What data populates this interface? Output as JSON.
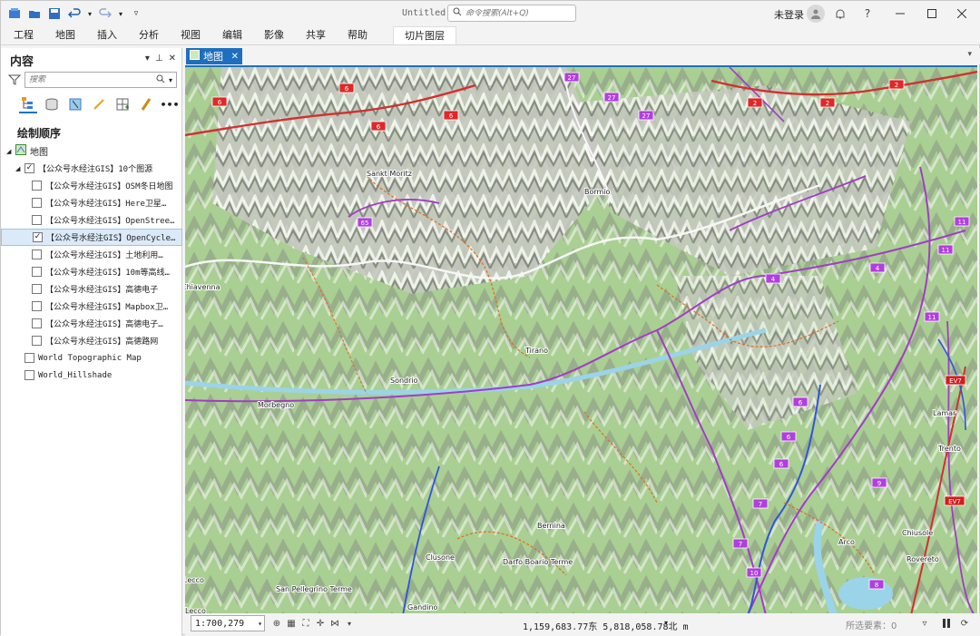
{
  "window": {
    "doc_title": "Untitled",
    "command_search_placeholder": "命令搜索(Alt+Q)",
    "account": "未登录"
  },
  "ribbon": {
    "tabs": [
      "工程",
      "地图",
      "插入",
      "分析",
      "视图",
      "编辑",
      "影像",
      "共享",
      "帮助"
    ],
    "context_tab": "切片图层"
  },
  "contents": {
    "title": "内容",
    "search_placeholder": "搜索",
    "drawing_order": "绘制顺序",
    "map_name": "地图",
    "group_name": "【公众号水经注GIS】10个图源",
    "layers": [
      {
        "name": "【公众号水经注GIS】OSM冬日地图",
        "checked": false,
        "selected": false
      },
      {
        "name": "【公众号水经注GIS】Here卫星…",
        "checked": false,
        "selected": false
      },
      {
        "name": "【公众号水经注GIS】OpenStree…",
        "checked": false,
        "selected": false
      },
      {
        "name": "【公众号水经注GIS】OpenCycle…",
        "checked": true,
        "selected": true
      },
      {
        "name": "【公众号水经注GIS】土地利用…",
        "checked": false,
        "selected": false
      },
      {
        "name": "【公众号水经注GIS】10m等高线…",
        "checked": false,
        "selected": false
      },
      {
        "name": "【公众号水经注GIS】高德电子",
        "checked": false,
        "selected": false
      },
      {
        "name": "【公众号水经注GIS】Mapbox卫…",
        "checked": false,
        "selected": false
      },
      {
        "name": "【公众号水经注GIS】高德电子…",
        "checked": false,
        "selected": false
      },
      {
        "name": "【公众号水经注GIS】高德路网",
        "checked": false,
        "selected": false
      }
    ],
    "basemaps": [
      "World Topographic Map",
      "World_Hillshade"
    ]
  },
  "map_tab": {
    "label": "地图"
  },
  "map": {
    "places": [
      "Sankt Moritz",
      "Bormio",
      "Chiavenna",
      "Tirano",
      "Sondrio",
      "Morbegno",
      "Bernina",
      "Darfo Boario Terme",
      "Clusone",
      "San Pellegrino Terme",
      "Gandino",
      "Arco",
      "Chiusole",
      "Rovereto",
      "Trento",
      "Lamar",
      "Lecco",
      "Lecco"
    ],
    "road_shields": [
      "6",
      "6",
      "6",
      "6",
      "27",
      "27",
      "27",
      "2",
      "2",
      "2",
      "65",
      "11",
      "11",
      "11",
      "4",
      "4",
      "6",
      "6",
      "6",
      "7",
      "7",
      "10",
      "9",
      "8",
      "EV7",
      "EV7"
    ]
  },
  "status": {
    "scale": "1:700,279",
    "coords": "1,159,683.77东 5,818,058.78北 m",
    "selected_features": "所选要素：0"
  }
}
